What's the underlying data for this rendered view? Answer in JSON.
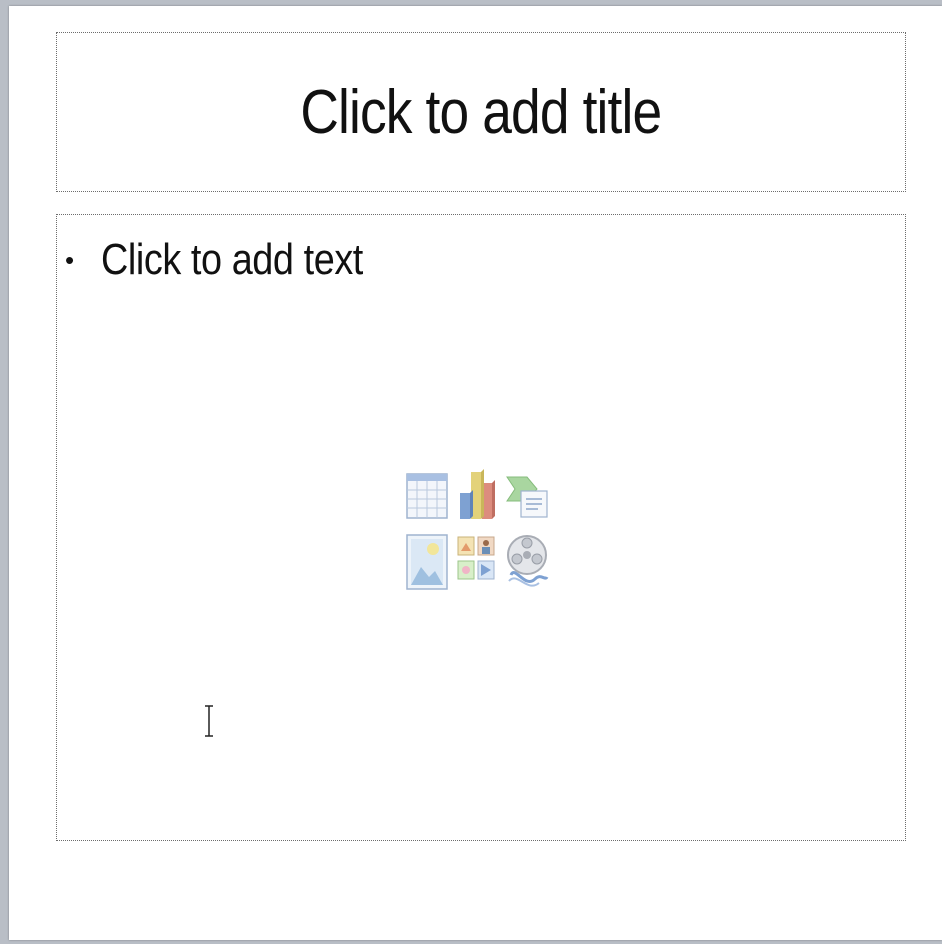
{
  "slide": {
    "title_placeholder": "Click to add title",
    "content_placeholder": {
      "bullet": "•",
      "text": "Click to add text"
    },
    "insert_icons": [
      {
        "name": "table-icon"
      },
      {
        "name": "chart-icon"
      },
      {
        "name": "smartart-icon"
      },
      {
        "name": "picture-icon"
      },
      {
        "name": "clipart-icon"
      },
      {
        "name": "media-clip-icon"
      }
    ]
  },
  "cursor": {
    "name": "text-cursor-icon"
  }
}
